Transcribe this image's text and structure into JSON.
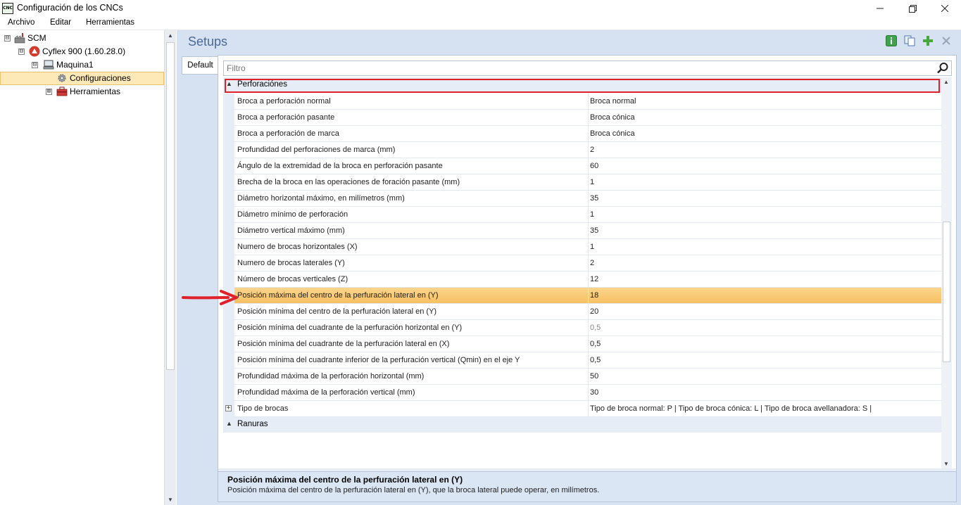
{
  "window": {
    "icon_text": "CNC",
    "title": "Configuración de los CNCs"
  },
  "menu": {
    "items": [
      "Archivo",
      "Editar",
      "Herramientas"
    ]
  },
  "tree": {
    "items": [
      {
        "label": "SCM",
        "expander": "⊟",
        "icon": "factory-icon"
      },
      {
        "label": "Cyflex 900 (1.60.28.0)",
        "expander": "⊟",
        "icon": "machine-logo-icon"
      },
      {
        "label": "Maquina1",
        "expander": "⊟",
        "icon": "computer-icon"
      },
      {
        "label": "Configuraciones",
        "expander": "",
        "icon": "gear-icon"
      },
      {
        "label": "Herramientas",
        "expander": "⊞",
        "icon": "toolbox-icon"
      }
    ]
  },
  "main": {
    "title": "Setups",
    "tab_label": "Default",
    "filter_placeholder": "Filtro",
    "toolbar_icons": [
      "info-icon",
      "copy-icon",
      "add-icon",
      "close-icon"
    ]
  },
  "grid": {
    "category": "Perforaciónes",
    "rows": [
      {
        "name": "Broca a perforación normal",
        "value": "Broca normal"
      },
      {
        "name": "Broca a perforación pasante",
        "value": "Broca cónica"
      },
      {
        "name": "Broca a perforación de marca",
        "value": "Broca cónica"
      },
      {
        "name": "Profundidad del perforaciones de marca (mm)",
        "value": "2"
      },
      {
        "name": "Ángulo de la extremidad de la broca en perforación pasante",
        "value": "60"
      },
      {
        "name": "Brecha de la broca en las operaciones de foración pasante (mm)",
        "value": "1"
      },
      {
        "name": "Diámetro horizontal máximo, en milímetros (mm)",
        "value": "35"
      },
      {
        "name": "Diámetro mínimo de perforación",
        "value": "1"
      },
      {
        "name": "Diámetro vertical máximo (mm)",
        "value": "35"
      },
      {
        "name": "Numero de brocas horizontales (X)",
        "value": "1"
      },
      {
        "name": "Numero de brocas laterales (Y)",
        "value": "2"
      },
      {
        "name": "Número de brocas verticales (Z)",
        "value": "12"
      },
      {
        "name": "Posición máxima del centro de la perfuración lateral en (Y)",
        "value": "18"
      },
      {
        "name": "Posición mínima del centro de la perfuración lateral en (Y)",
        "value": "20"
      },
      {
        "name": "Posición mínima del cuadrante de la perfuración horizontal en (Y)",
        "value": "0,5"
      },
      {
        "name": "Posición mínima del cuadrante de la perfuración lateral en (X)",
        "value": "0,5"
      },
      {
        "name": "Posición mínima del cuadrante inferior de la perfuración vertical (Qmin) en el eje Y",
        "value": "0,5"
      },
      {
        "name": "Profundidad máxima de la perforación horizontal (mm)",
        "value": "50"
      },
      {
        "name": "Profundidad máxima de la perforación vertical (mm)",
        "value": "30"
      },
      {
        "name": "Tipo de brocas",
        "value": "Tipo de broca normal: P  |  Tipo de broca cónica: L  |  Tipo de broca avellanadora: S  |"
      }
    ],
    "next_category": "Ranuras",
    "selected_index": 12
  },
  "description": {
    "title": "Posición máxima del centro de la perfuración lateral en (Y)",
    "text": "Posición máxima del centro de la perfuración lateral en (Y), que la broca lateral puede operar, en milímetros."
  },
  "colors": {
    "accent": "#4a6a96",
    "selection": "#f7c062",
    "highlight_border": "#e0202a",
    "annotation_arrow": "#e0202a"
  }
}
